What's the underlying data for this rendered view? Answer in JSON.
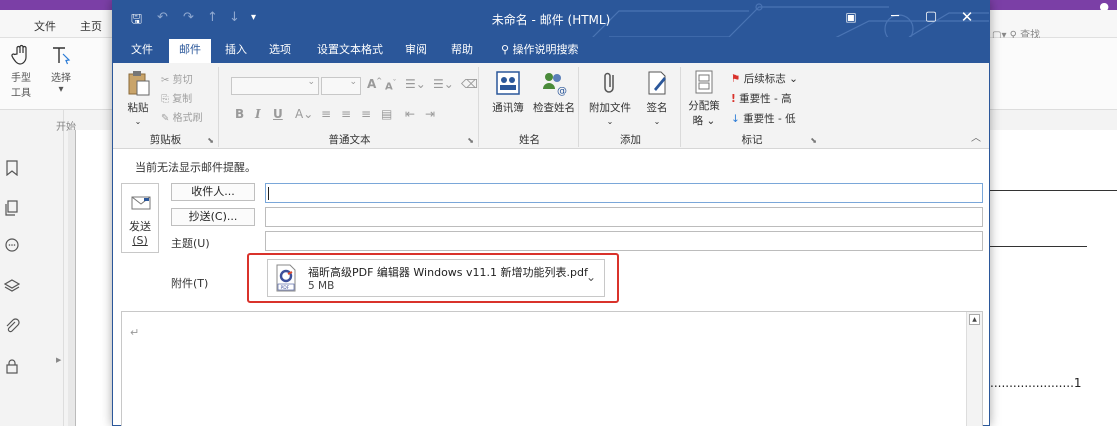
{
  "background_app": {
    "menu": [
      "文件",
      "主页"
    ],
    "tools": [
      {
        "label_line1": "手型",
        "label_line2": "工具"
      },
      {
        "label_line1": "选择",
        "label_line2": "▾"
      }
    ],
    "breadcrumb": "开始",
    "search_placeholder": "查找",
    "page_number_leader": "......................1"
  },
  "window": {
    "title": "未命名 - 邮件 (HTML)",
    "quick_access": [
      "save-icon",
      "undo-icon",
      "redo-icon",
      "up-icon",
      "down-icon",
      "customize-icon"
    ],
    "tabs": [
      {
        "label": "文件",
        "active": false
      },
      {
        "label": "邮件",
        "active": true
      },
      {
        "label": "插入",
        "active": false
      },
      {
        "label": "选项",
        "active": false
      },
      {
        "label": "设置文本格式",
        "active": false
      },
      {
        "label": "审阅",
        "active": false
      },
      {
        "label": "帮助",
        "active": false
      }
    ],
    "tell_me": "操作说明搜索"
  },
  "ribbon": {
    "clipboard": {
      "label": "剪贴板",
      "paste": "粘贴",
      "cut": "剪切",
      "copy": "复制",
      "format_painter": "格式刷"
    },
    "basic_text": {
      "label": "普通文本"
    },
    "names": {
      "label": "姓名",
      "address_book": "通讯簿",
      "check_names": "检查姓名"
    },
    "include": {
      "label": "添加",
      "attach_file": "附加文件",
      "signature": "签名"
    },
    "tags": {
      "label": "标记",
      "assign_policy_line1": "分配策",
      "assign_policy_line2": "略 ⌄",
      "follow_up": "后续标志 ⌄",
      "high_importance": "重要性 - 高",
      "low_importance": "重要性 - 低"
    }
  },
  "compose": {
    "info": "当前无法显示邮件提醒。",
    "send_line1": "发送",
    "send_line2": "(S)",
    "to_button": "收件人...",
    "cc_button": "抄送(C)...",
    "subject_label": "主题(U)",
    "attachment_label": "附件(T)",
    "attachment": {
      "name": "福昕高级PDF 编辑器 Windows v11.1 新增功能列表.pdf",
      "size": "5 MB"
    },
    "body_mark": "↵"
  },
  "colors": {
    "title_blue": "#2b579a",
    "highlight_red": "#d9322b",
    "bg_app_purple": "#7b3fa6"
  }
}
